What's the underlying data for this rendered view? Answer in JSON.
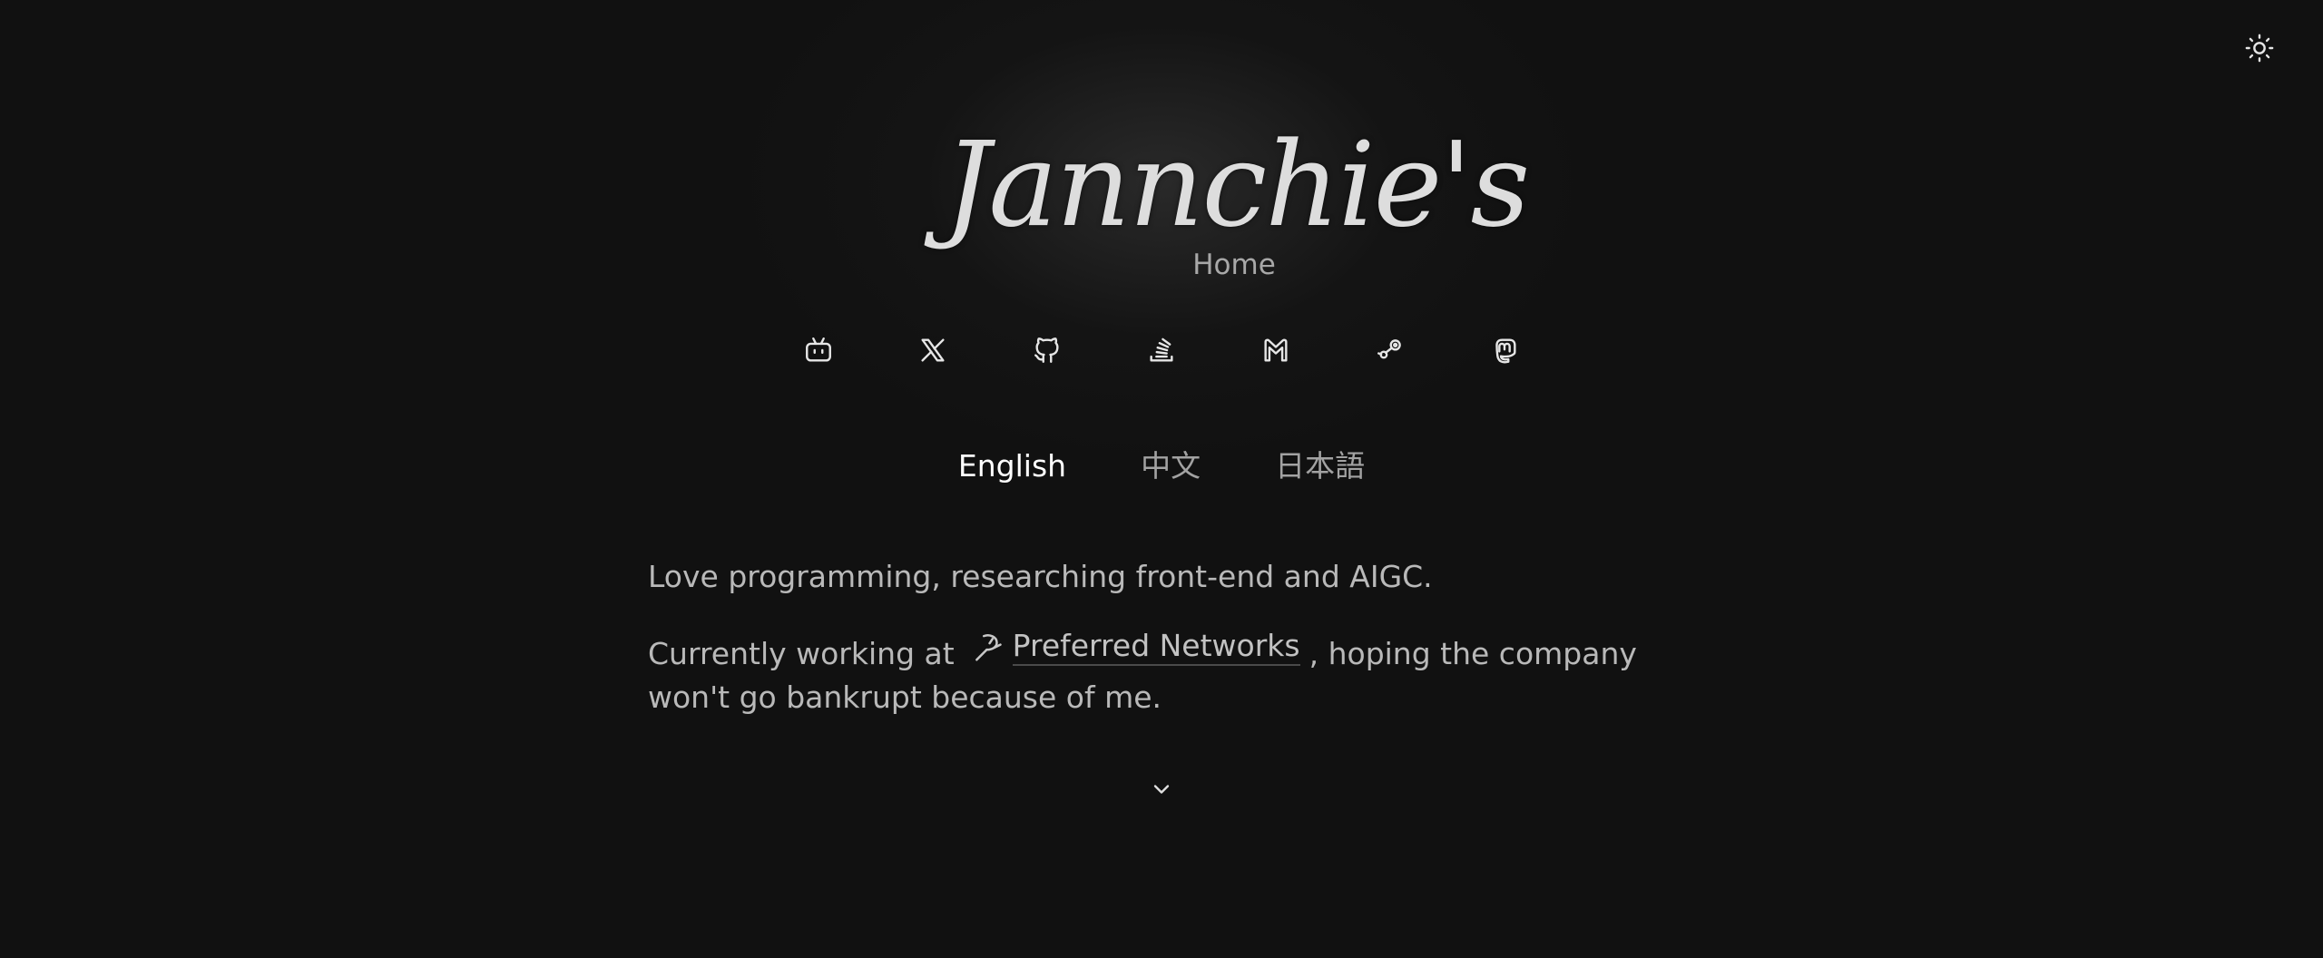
{
  "theme_toggle": {
    "icon": "sun-icon"
  },
  "header": {
    "brand": "Jannchie's",
    "home_link": "Home"
  },
  "socials": [
    {
      "name": "bilibili",
      "icon": "bilibili-icon"
    },
    {
      "name": "x",
      "icon": "x-icon"
    },
    {
      "name": "github",
      "icon": "github-icon"
    },
    {
      "name": "stackoverflow",
      "icon": "stackoverflow-icon"
    },
    {
      "name": "gmail",
      "icon": "gmail-icon"
    },
    {
      "name": "steam",
      "icon": "steam-icon"
    },
    {
      "name": "mastodon",
      "icon": "mastodon-icon"
    }
  ],
  "languages": {
    "items": [
      {
        "label": "English",
        "active": true
      },
      {
        "label": "中文",
        "active": false
      },
      {
        "label": "日本語",
        "active": false
      }
    ]
  },
  "content": {
    "intro": "Love programming, researching front-end and AIGC.",
    "work_prefix": "Currently working at",
    "company_name": "Preferred Networks",
    "company_icon": "preferred-networks-logo-icon",
    "work_suffix": ", hoping the company won't go bankrupt because of me."
  },
  "scroll": {
    "icon": "chevron-down-icon"
  },
  "colors": {
    "background": "#111111",
    "text": "#bdbdbd",
    "active_language": "#ffffff",
    "brand": "#dddddd"
  }
}
